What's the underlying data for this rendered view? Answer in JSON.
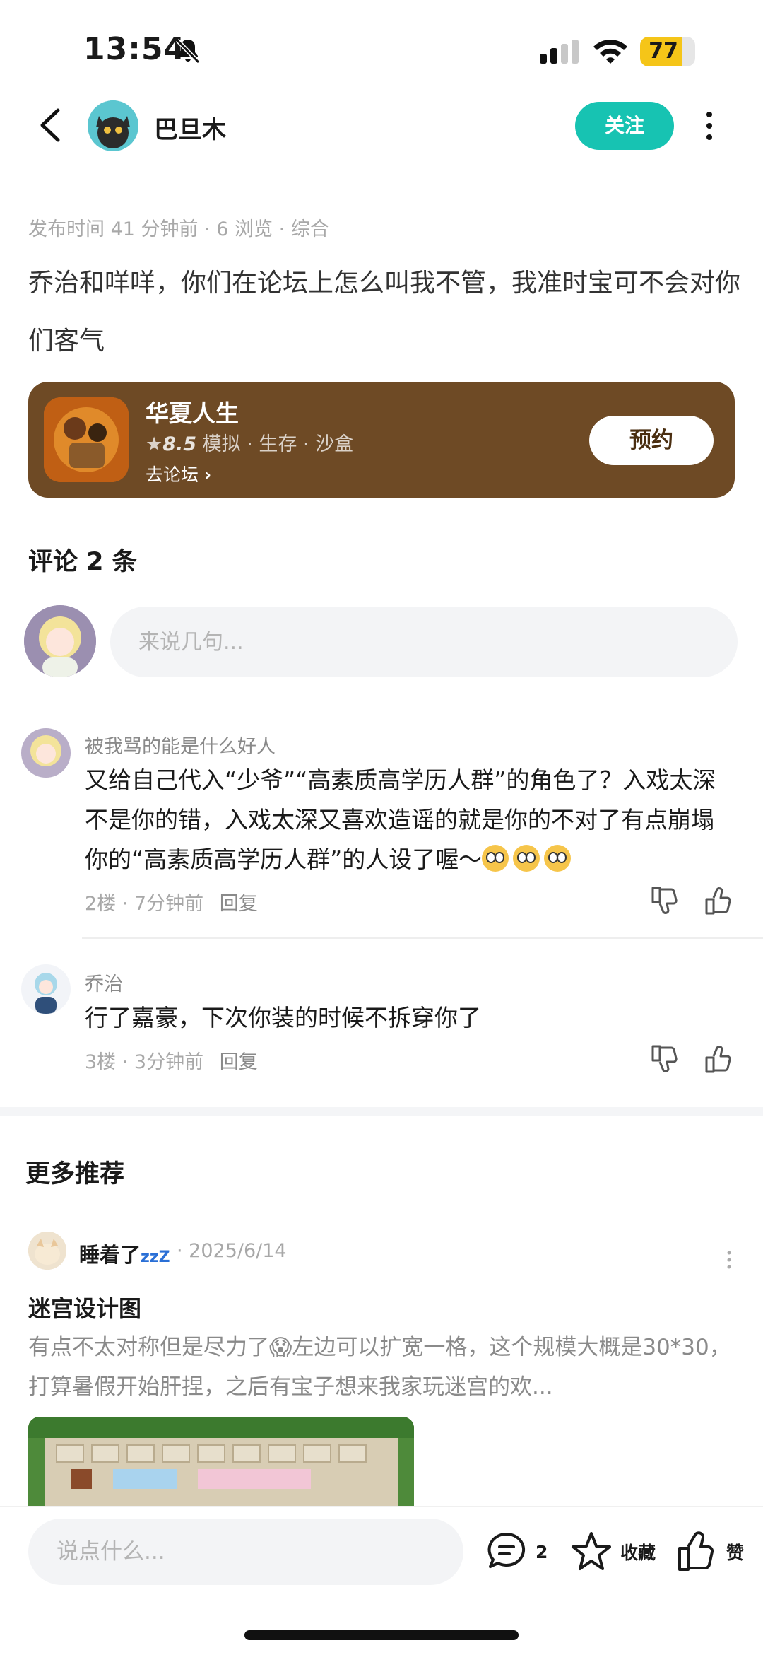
{
  "status_bar": {
    "time": "13:54",
    "battery": "77",
    "battery_level": 0.77
  },
  "header": {
    "author_name": "巴旦木",
    "follow_label": "关注"
  },
  "post": {
    "meta": "发布时间 41 分钟前 · 6 浏览 · 综合",
    "body": "乔治和咩咩，你们在论坛上怎么叫我不管，我准时宝可不会对你们客气"
  },
  "game_card": {
    "title": "华夏人生",
    "rating": "8.5",
    "tags": "模拟 · 生存 · 沙盒",
    "forum_link": "去论坛",
    "reserve_label": "预约"
  },
  "comments": {
    "title": "评论 2 条",
    "input_placeholder": "来说几句...",
    "items": [
      {
        "user": "被我骂的能是什么好人",
        "text": "又给自己代入“少爷”“高素质高学历人群”的角色了？入戏太深不是你的错，入戏太深又喜欢造谣的就是你的不对了有点崩塌你的“高素质高学历人群”的人设了喔～",
        "meta": "2楼 · 7分钟前",
        "reply_label": "回复"
      },
      {
        "user": "乔治",
        "text": "行了嘉豪，下次你装的时候不拆穿你了",
        "meta": "3楼 · 3分钟前",
        "reply_label": "回复"
      }
    ]
  },
  "recommend": {
    "title": "更多推荐",
    "user": "睡着了",
    "user_suffix": "zzZ",
    "date": "· 2025/6/14",
    "post_title": "迷宫设计图",
    "desc": "有点不太对称但是尽力了😱左边可以扩宽一格，这个规模大概是30*30，打算暑假开始肝捏，之后有宝子想来我家玩迷宫的欢..."
  },
  "bottom_bar": {
    "input_placeholder": "说点什么...",
    "comment_count": "2",
    "favorite_label": "收藏",
    "like_label": "赞"
  },
  "colors": {
    "accent": "#17c3b2",
    "card_bg": "#6e4a25",
    "battery": "#f5c518"
  },
  "icons": [
    "bell-off-icon",
    "signal-icon",
    "wifi-icon",
    "back-icon",
    "more-vertical-icon",
    "star-icon",
    "chevron-right-icon",
    "thumbs-down-icon",
    "thumbs-up-icon",
    "comment-icon",
    "favorite-star-icon",
    "like-icon"
  ]
}
